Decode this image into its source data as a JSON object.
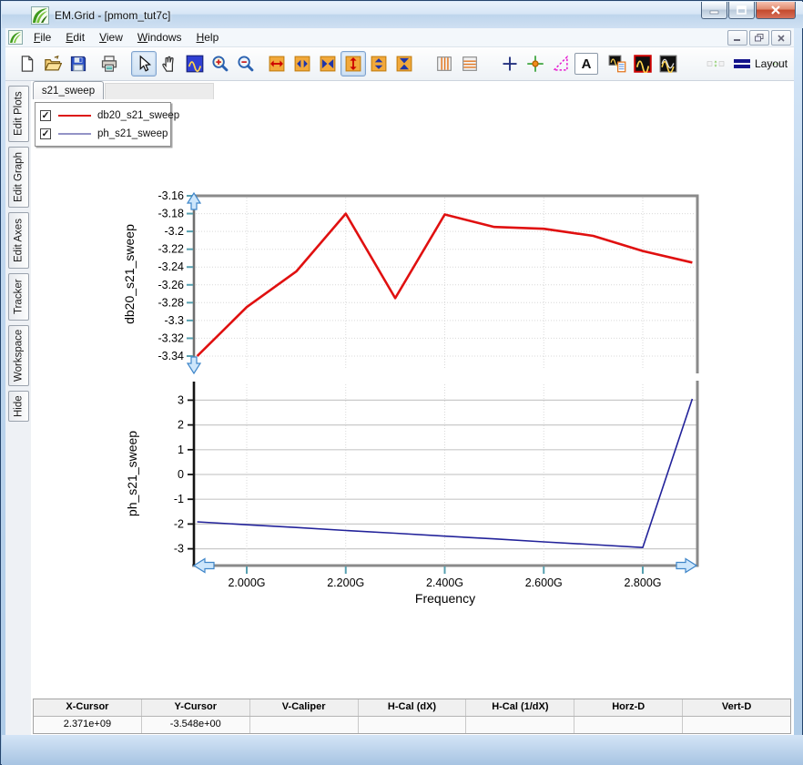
{
  "window": {
    "title": "EM.Grid - [pmom_tut7c]"
  },
  "menu": {
    "items": [
      "File",
      "Edit",
      "View",
      "Windows",
      "Help"
    ]
  },
  "toolbar": {
    "icons": [
      "new-document",
      "open-file",
      "save",
      "print",
      "select-cursor",
      "pan-hand",
      "fit-view",
      "zoom-in",
      "zoom-out",
      "expand-x",
      "shrink-x",
      "center-x",
      "expand-y",
      "shrink-y",
      "center-y",
      "vertical-gridlines",
      "horizontal-gridlines",
      "cross-cursor",
      "tracker",
      "caliper",
      "add-text",
      "plot-with-legend",
      "plot-single",
      "plot-overlay",
      "align-vertical",
      "align-horizontal",
      "layout"
    ],
    "text_icon_label": "A",
    "layout_label": "Layout"
  },
  "sidebar": {
    "tabs": [
      "Edit Plots",
      "Edit Graph",
      "Edit Axes",
      "Tracker",
      "Workspace",
      "Hide"
    ]
  },
  "document_tabs": {
    "active": "s21_sweep"
  },
  "legend": {
    "items": [
      {
        "label": "db20_s21_sweep",
        "checked": true,
        "color": "#dd1512"
      },
      {
        "label": "ph_s21_sweep",
        "checked": true,
        "color": "#9393c6"
      }
    ]
  },
  "chart_data": [
    {
      "type": "line",
      "ylabel": "db20_s21_sweep",
      "xlabel": "Frequency",
      "x_unit": "GHz",
      "x": [
        1.9,
        2.0,
        2.1,
        2.2,
        2.3,
        2.4,
        2.5,
        2.6,
        2.7,
        2.8,
        2.9
      ],
      "series": [
        {
          "name": "db20_s21_sweep",
          "color": "#e01010",
          "values": [
            -3.34,
            -3.285,
            -3.245,
            -3.18,
            -3.275,
            -3.181,
            -3.195,
            -3.197,
            -3.205,
            -3.222,
            -3.235
          ]
        }
      ],
      "xlim": [
        1.895,
        2.915
      ],
      "ylim": [
        -3.355,
        -3.158
      ],
      "xticks": [
        2.0,
        2.2,
        2.4,
        2.6,
        2.8
      ],
      "xtick_labels": [
        "2.000G",
        "2.200G",
        "2.400G",
        "2.600G",
        "2.800G"
      ],
      "yticks": [
        -3.16,
        -3.18,
        -3.2,
        -3.22,
        -3.24,
        -3.26,
        -3.28,
        -3.3,
        -3.32,
        -3.34
      ],
      "ytick_labels": [
        "-3.16",
        "-3.18",
        "-3.2",
        "-3.22",
        "-3.24",
        "-3.26",
        "-3.28",
        "-3.3",
        "-3.32",
        "-3.34"
      ],
      "grid": true,
      "legend_position": "top-left-overlay"
    },
    {
      "type": "line",
      "ylabel": "ph_s21_sweep",
      "xlabel": "Frequency",
      "x_unit": "GHz",
      "x": [
        1.9,
        2.0,
        2.1,
        2.2,
        2.3,
        2.4,
        2.5,
        2.6,
        2.7,
        2.8,
        2.9
      ],
      "series": [
        {
          "name": "ph_s21_sweep",
          "color": "#22229a",
          "values": [
            -1.91,
            -2.03,
            -2.14,
            -2.26,
            -2.37,
            -2.49,
            -2.6,
            -2.72,
            -2.83,
            -2.95,
            3.05
          ]
        }
      ],
      "xlim": [
        1.895,
        2.915
      ],
      "ylim": [
        -3.7,
        3.7
      ],
      "xticks": [
        2.0,
        2.2,
        2.4,
        2.6,
        2.8
      ],
      "xtick_labels": [
        "2.000G",
        "2.200G",
        "2.400G",
        "2.600G",
        "2.800G"
      ],
      "yticks": [
        3,
        2,
        1,
        0,
        -1,
        -2,
        -3
      ],
      "ytick_labels": [
        "3",
        "2",
        "1",
        "0",
        "-1",
        "-2",
        "-3"
      ],
      "grid": true
    }
  ],
  "cursor_table": {
    "headers": [
      "X-Cursor",
      "Y-Cursor",
      "V-Caliper",
      "H-Cal (dX)",
      "H-Cal (1/dX)",
      "Horz-D",
      "Vert-D"
    ],
    "values": [
      "2.371e+09",
      "-3.548e+00",
      "",
      "",
      "",
      "",
      ""
    ]
  }
}
